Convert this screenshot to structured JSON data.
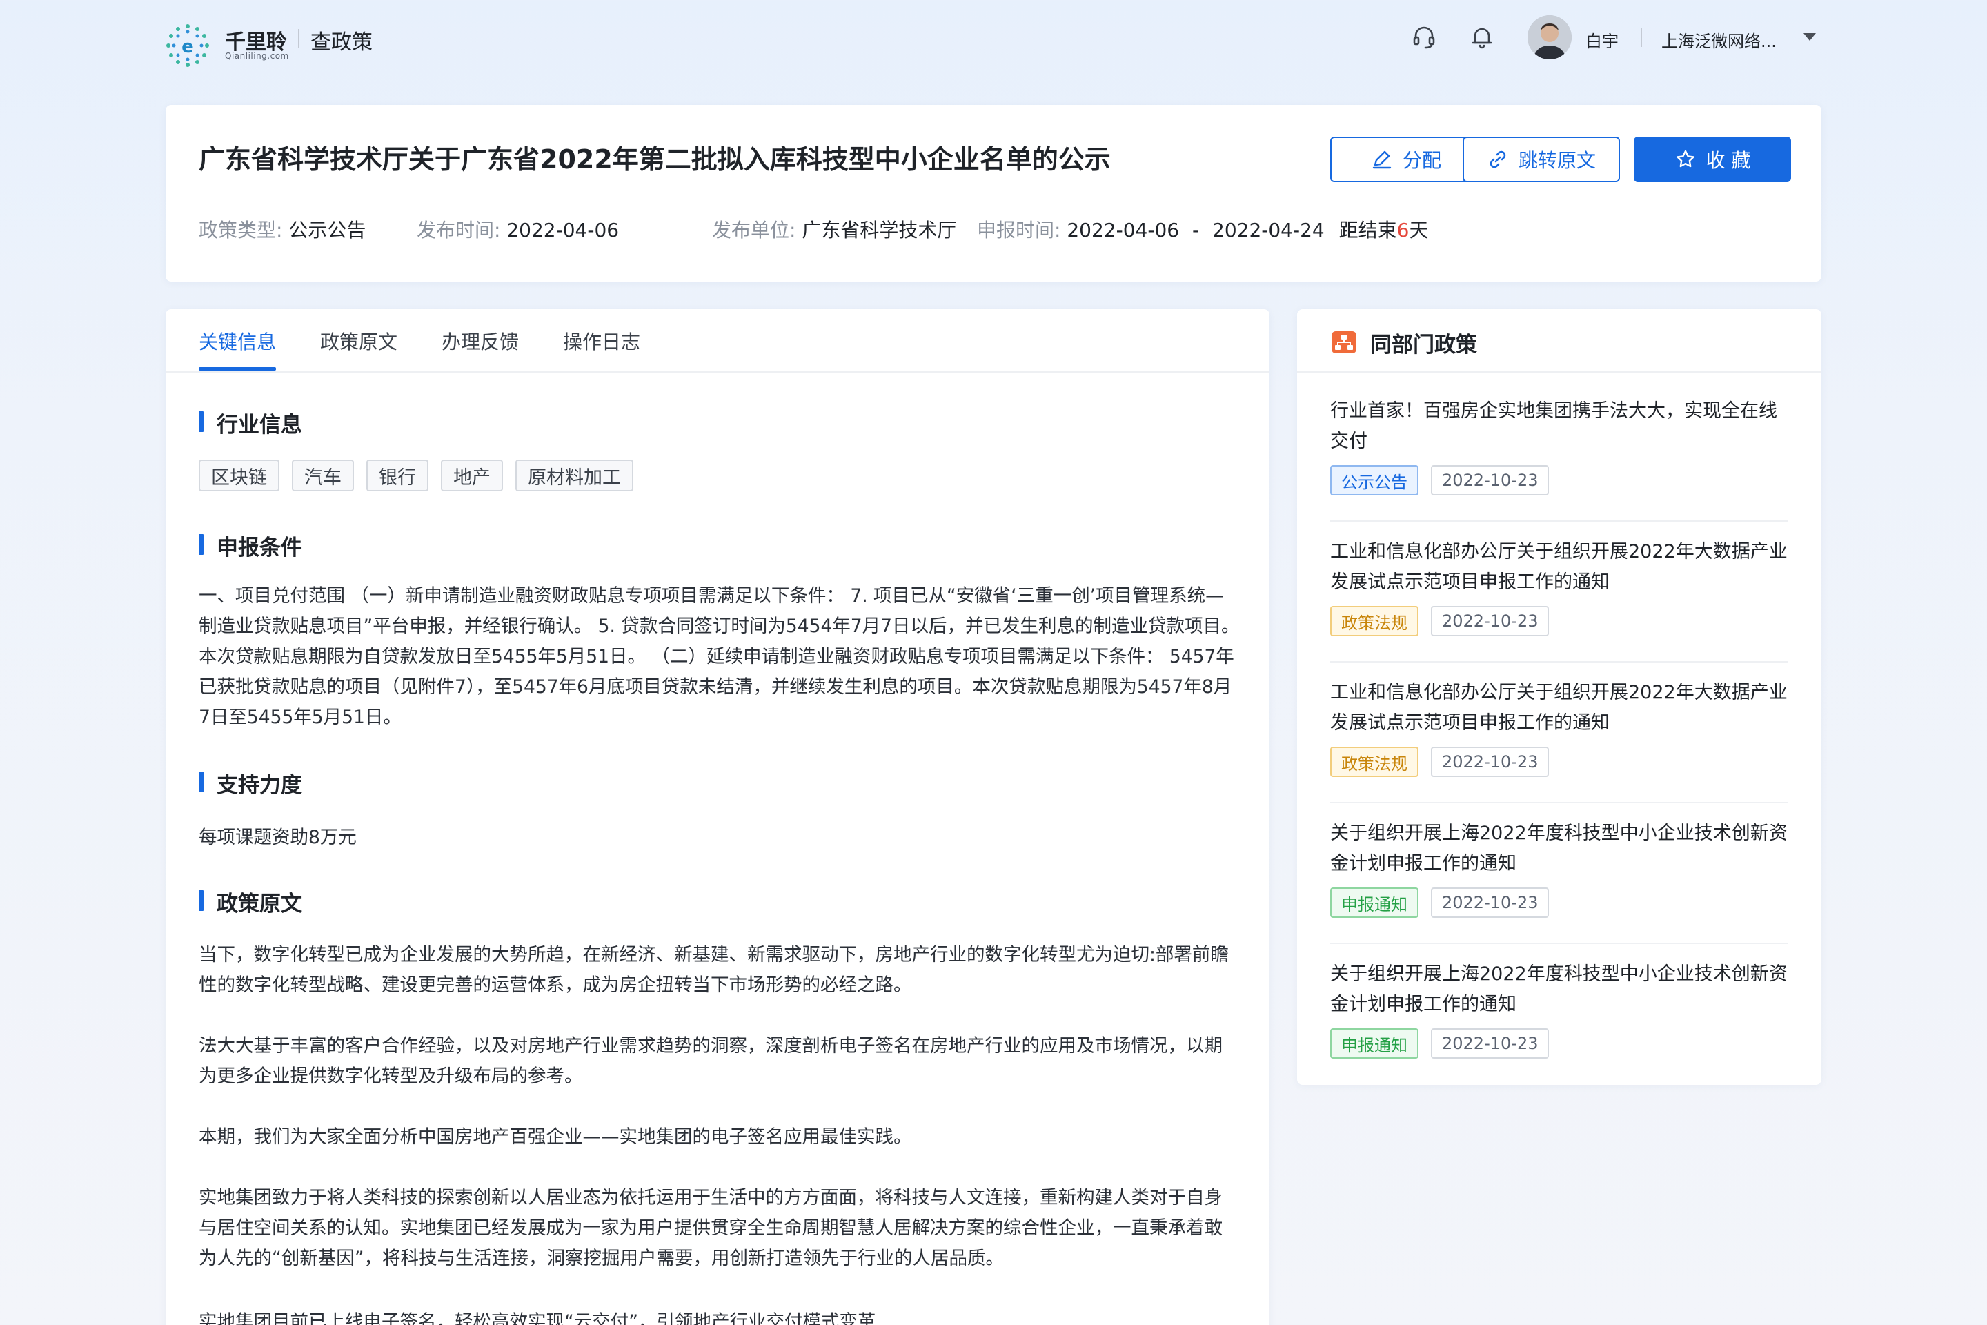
{
  "brand": {
    "name": "千里聆",
    "domain": "Qianliling.com",
    "section": "查政策"
  },
  "header": {
    "user_name": "白宇",
    "org_name": "上海泛微网络..."
  },
  "policy": {
    "title": "广东省科学技术厅关于广东省2022年第二批拟入库科技型中小企业名单的公示",
    "buttons": {
      "assign": "分配",
      "jump": "跳转原文",
      "favorite": "收 藏"
    },
    "meta": {
      "type_label": "政策类型:",
      "type_value": "公示公告",
      "publish_label": "发布时间:",
      "publish_value": "2022-04-06",
      "unit_label": "发布单位:",
      "unit_value": "广东省科学技术厅",
      "apply_label": "申报时间:",
      "apply_start": "2022-04-06",
      "apply_dash": "-",
      "apply_end": "2022-04-24",
      "remain_prefix": "距结束",
      "remain_days": "6",
      "remain_suffix": "天"
    }
  },
  "tabs": [
    "关键信息",
    "政策原文",
    "办理反馈",
    "操作日志"
  ],
  "sections": {
    "industry_title": "行业信息",
    "industry_tags": [
      "区块链",
      "汽车",
      "银行",
      "地产",
      "原材料加工"
    ],
    "conditions_title": "申报条件",
    "conditions_text": "一、项目兑付范围 （一）新申请制造业融资财政贴息专项项目需满足以下条件： 7. 项目已从“安徽省‘三重一创’项目管理系统—制造业贷款贴息项目”平台申报，并经银行确认。 5. 贷款合同签订时间为5454年7月7日以后，并已发生利息的制造业贷款项目。本次贷款贴息期限为自贷款发放日至5455年5月51日。 （二）延续申请制造业融资财政贴息专项项目需满足以下条件： 5457年已获批贷款贴息的项目（见附件7），至5457年6月底项目贷款未结清，并继续发生利息的项目。本次贷款贴息期限为5457年8月7日至5455年5月51日。",
    "support_title": "支持力度",
    "support_text": "每项课题资助8万元",
    "original_title": "政策原文",
    "original_paragraphs": [
      "当下，数字化转型已成为企业发展的大势所趋，在新经济、新基建、新需求驱动下，房地产行业的数字化转型尤为迫切:部署前瞻性的数字化转型战略、建设更完善的运营体系，成为房企扭转当下市场形势的必经之路。",
      "法大大基于丰富的客户合作经验，以及对房地产行业需求趋势的洞察，深度剖析电子签名在房地产行业的应用及市场情况，以期为更多企业提供数字化转型及升级布局的参考。",
      "本期，我们为大家全面分析中国房地产百强企业——实地集团的电子签名应用最佳实践。",
      "实地集团致力于将人类科技的探索创新以人居业态为依托运用于生活中的方方面面，将科技与人文连接，重新构建人类对于自身与居住空间关系的认知。实地集团已经发展成为一家为用户提供贯穿全生命周期智慧人居解决方案的综合性企业，一直秉承着敢为人先的“创新基因”，将科技与生活连接，洞察挖掘用户需要，用创新打造领先于行业的人居品质。",
      "实地集团目前已上线电子签名，轻松高效实现“云交付”，引领地产行业交付模式变革"
    ]
  },
  "side": {
    "title": "同部门政策",
    "items": [
      {
        "title": "行业首家！百强房企实地集团携手法大大，实现全在线交付",
        "tag": "公示公告",
        "tag_color": "blue",
        "date": "2022-10-23"
      },
      {
        "title": "工业和信息化部办公厅关于组织开展2022年大数据产业发展试点示范项目申报工作的通知",
        "tag": "政策法规",
        "tag_color": "yellow",
        "date": "2022-10-23"
      },
      {
        "title": "工业和信息化部办公厅关于组织开展2022年大数据产业发展试点示范项目申报工作的通知",
        "tag": "政策法规",
        "tag_color": "yellow",
        "date": "2022-10-23"
      },
      {
        "title": "关于组织开展上海2022年度科技型中小企业技术创新资金计划申报工作的通知",
        "tag": "申报通知",
        "tag_color": "green",
        "date": "2022-10-23"
      },
      {
        "title": "关于组织开展上海2022年度科技型中小企业技术创新资金计划申报工作的通知",
        "tag": "申报通知",
        "tag_color": "green",
        "date": "2022-10-23"
      }
    ]
  },
  "colors": {
    "primary": "#1769e0",
    "accent_red": "#e5473c",
    "tag_blue": "#1769e0",
    "tag_yellow": "#c8850a",
    "tag_green": "#24a045"
  }
}
